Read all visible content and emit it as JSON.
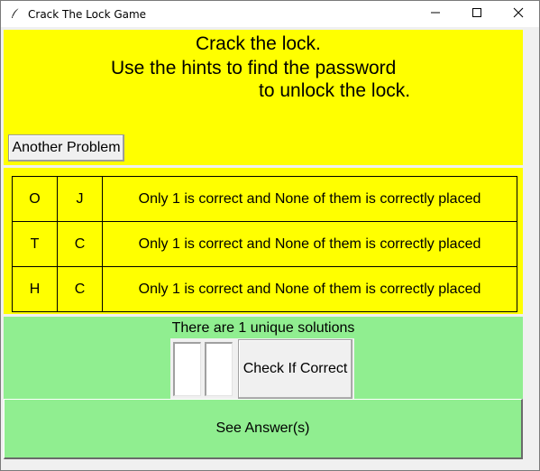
{
  "window": {
    "title": "Crack The Lock Game"
  },
  "header": {
    "line1": "Crack the lock.",
    "line2": "Use the hints to find the password",
    "line3": "to unlock the lock.",
    "another_label": "Another Problem",
    "background": "#ffff00"
  },
  "hints": {
    "rows": [
      {
        "c1": "O",
        "c2": "J",
        "text": "Only 1 is correct and None of them is correctly placed"
      },
      {
        "c1": "T",
        "c2": "C",
        "text": "Only 1 is correct and None of them is correctly placed"
      },
      {
        "c1": "H",
        "c2": "C",
        "text": "Only 1 is correct and None of them is correctly placed"
      }
    ]
  },
  "bottom": {
    "unique_text": "There are 1 unique solutions",
    "entry1_value": "",
    "entry2_value": "",
    "check_label": "Check If Correct",
    "see_answer_label": "See Answer(s)",
    "background": "#90ee90"
  },
  "icons": {
    "app": "feather-icon",
    "minimize": "minimize-icon",
    "maximize": "maximize-icon",
    "close": "close-icon"
  }
}
